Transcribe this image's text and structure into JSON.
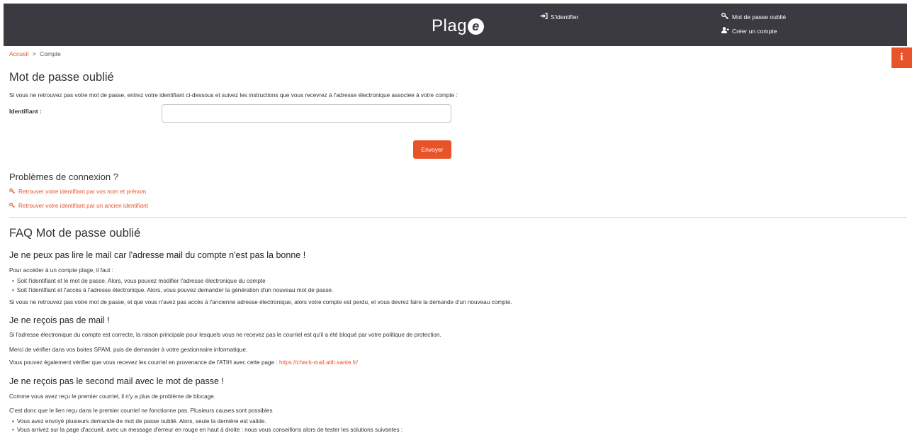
{
  "header": {
    "logo_text": "Plag",
    "logo_badge": "e",
    "login_label": "S'identifier",
    "forgot_label": "Mot de passe oublié",
    "create_label": "Créer un compte"
  },
  "breadcrumb": {
    "home": "Accueil",
    "separator": ">",
    "current": "Compte"
  },
  "form": {
    "title": "Mot de passe oublié",
    "intro": "Si vous ne retrouvez pas votre mot de passe, entrez votre identifiant ci-dessous et suivez les instructions que vous recevrez à l'adresse électronique associée à votre compte :",
    "identifier_label": "Identifiant :",
    "identifier_value": "",
    "submit_label": "Envoyer"
  },
  "problems": {
    "title": "Problèmes de connexion ?",
    "links": [
      "Retrouver votre identifiant par vos nom et prénom",
      "Retrouver votre identifiant par un ancien identifiant"
    ]
  },
  "faq": {
    "title": "FAQ Mot de passe oublié",
    "q1": {
      "title": "Je ne peux pas lire le mail car l'adresse mail du compte n'est pas la bonne !",
      "intro": "Pour accéder à un compte plage, il faut :",
      "bullets": [
        "Soit l'identifiant et le mot de passe. Alors, vous pouvez modifier l'adresse électronique du compte",
        "Soit l'identifiant et l'accès à l'adresse électronique. Alors, vous pouvez demander la génération d'un nouveau mot de passe."
      ],
      "outro": "Si vous ne retrouvez pas votre mot de passe, et que vous n'avez pas accès à l'ancienne adresse électronique, alors votre compte est perdu, et vous devrez faire la demande d'un nouveau compte."
    },
    "q2": {
      "title": "Je ne reçois pas de mail !",
      "p1": "Si l'adresse électronique du compte est correcte, la raison principale pour lesquels vous ne recevez pas le courriel est qu'il a été bloqué par votre politique de protection.",
      "p2": "Merci de vérifier dans vos boites SPAM, puis de demander à votre gestionnaire informatique.",
      "p3": "Vous pouvez également vérifier que vous recevez les courriel en provenance de l'ATIH avec cette page :",
      "link": "https://check-mail.atih.sante.fr/"
    },
    "q3": {
      "title": "Je ne reçois pas le second mail avec le mot de passe !",
      "p1": "Comme vous avez reçu le premier courriel, il n'y a plus de problème de blocage.",
      "p2": "C'est donc que le lien reçu dans le premier courriel ne fonctionne pas. Plusieurs causes sont possibles",
      "bullets": [
        "Vous avez envoyé plusieurs demande de mot de passe oublié. Alors, seule la dernière est valide.",
        "Vous arrivez sur la page d'accueil, avec un message d'erreur en rouge en haut à droite : nous vous conseillons alors de tester les solutions suivantes :"
      ]
    }
  },
  "info_button": "i"
}
